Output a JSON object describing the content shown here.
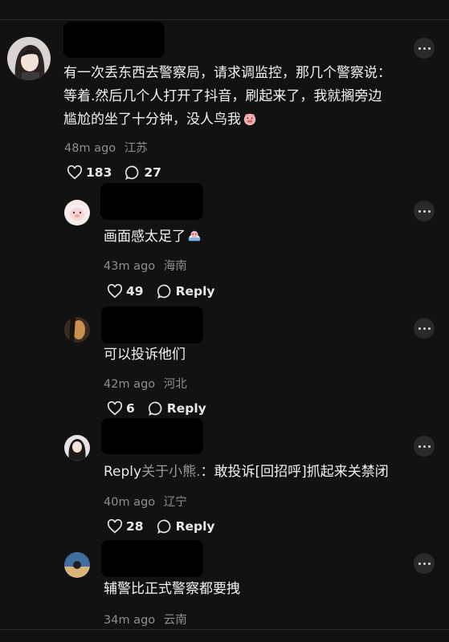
{
  "comments": [
    {
      "text_lines": [
        "有一次丢东西去警察局，请求调监控，那几个警察说：",
        "等着.然后几个人打开了抖音，刷起来了，我就搁旁边",
        "尴尬的坐了十分钟，没人鸟我"
      ],
      "emoji": "pig-face-emoji",
      "time": "48m ago",
      "location": "江苏",
      "likes": "183",
      "replies": "27"
    },
    {
      "text": "画面感太足了",
      "emoji": "pig-in-bath-emoji",
      "time": "43m ago",
      "location": "海南",
      "likes": "49",
      "reply_label": "Reply"
    },
    {
      "text": "可以投诉他们",
      "time": "42m ago",
      "location": "河北",
      "likes": "6",
      "reply_label": "Reply"
    },
    {
      "reply_prefix": "Reply",
      "reply_to": "关于小熊.",
      "text": "：敢投诉[回招呼]抓起来关禁闭",
      "time": "40m ago",
      "location": "辽宁",
      "likes": "28",
      "reply_label": "Reply"
    },
    {
      "text": "辅警比正式警察都要拽",
      "time": "34m ago",
      "location": "云南"
    }
  ],
  "colors": {
    "background": "#121212",
    "meta": "#8e8e8e",
    "text": "#f2f2f2"
  }
}
